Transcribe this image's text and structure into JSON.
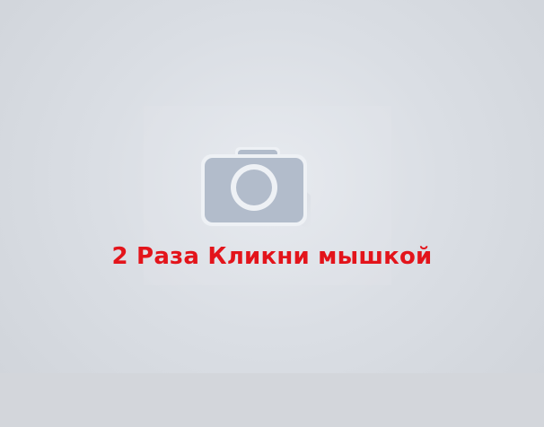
{
  "instruction_text": "2 Раза Кликни мышкой",
  "icon": "camera-icon",
  "colors": {
    "background": "#dadee4",
    "camera_body": "#b2bccb",
    "camera_lens_ring": "#f2f4f7",
    "instruction_text": "#e3141b"
  }
}
